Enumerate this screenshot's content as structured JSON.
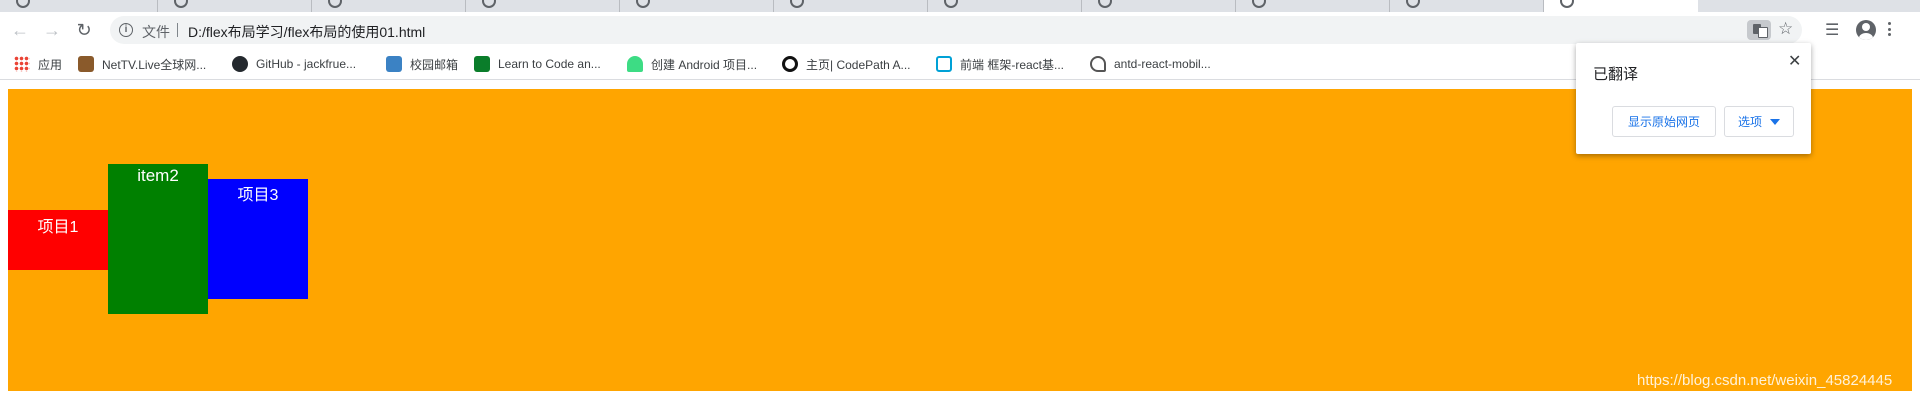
{
  "browser": {
    "address_bar": {
      "scheme_label": "文件",
      "url": "D:/flex布局学习/flex布局的使用01.html"
    },
    "bookmarks": [
      {
        "label": "应用",
        "icon": "apps-icon"
      },
      {
        "label": "NetTV.Live全球网...",
        "icon": "tv-icon"
      },
      {
        "label": "GitHub - jackfrue...",
        "icon": "github-icon"
      },
      {
        "label": "校园邮箱",
        "icon": "mail-icon"
      },
      {
        "label": "Learn to Code an...",
        "icon": "freecodecamp-icon"
      },
      {
        "label": "创建 Android 项目...",
        "icon": "android-icon"
      },
      {
        "label": "主页| CodePath A...",
        "icon": "codepath-icon"
      },
      {
        "label": "前端 框架-react基...",
        "icon": "bilibili-icon"
      },
      {
        "label": "antd-react-mobil...",
        "icon": "antd-icon"
      }
    ]
  },
  "translate_popup": {
    "title": "已翻译",
    "show_original_label": "显示原始网页",
    "options_label": "选项"
  },
  "page": {
    "items": [
      {
        "label": "项目1",
        "color": "#ff0000"
      },
      {
        "label": "item2",
        "color": "#008000"
      },
      {
        "label": "项目3",
        "color": "#0000ff"
      }
    ],
    "container_color": "#ffa500",
    "watermark": "https://blog.csdn.net/weixin_45824445"
  }
}
